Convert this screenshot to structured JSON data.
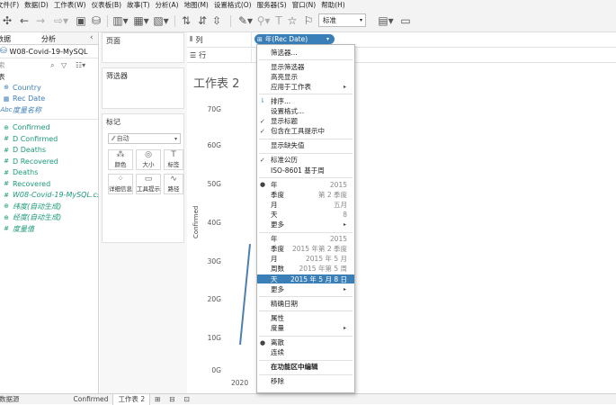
{
  "menubar": [
    "文件(F)",
    "数据(D)",
    "工作表(W)",
    "仪表板(B)",
    "故事(T)",
    "分析(A)",
    "地图(M)",
    "设置格式(O)",
    "服务器(S)",
    "窗口(N)",
    "帮助(H)"
  ],
  "toolbar": {
    "zoom_value": "标准"
  },
  "left_panel": {
    "tabs": [
      "数据",
      "分析"
    ],
    "datasource": "W08-Covid-19-MySQL",
    "search_placeholder": "索",
    "section_label": "表",
    "fields": [
      {
        "icon": "globe",
        "name": "Country",
        "kind": "dim"
      },
      {
        "icon": "calendar",
        "name": "Rec Date",
        "kind": "dim"
      },
      {
        "icon": "abc",
        "name": "度量名称",
        "kind": "dim",
        "italic": true
      },
      {
        "icon": "globe",
        "name": "Confirmed",
        "kind": "meas"
      },
      {
        "icon": "#",
        "name": "D Confirmed",
        "kind": "meas"
      },
      {
        "icon": "#",
        "name": "D Deaths",
        "kind": "meas"
      },
      {
        "icon": "#",
        "name": "D Recovered",
        "kind": "meas"
      },
      {
        "icon": "#",
        "name": "Deaths",
        "kind": "meas"
      },
      {
        "icon": "#",
        "name": "Recovered",
        "kind": "meas"
      },
      {
        "icon": "#",
        "name": "W08-Covid-19-MySQL.csv ...",
        "kind": "meas",
        "italic": true
      },
      {
        "icon": "globe",
        "name": "纬度(自动生成)",
        "kind": "meas",
        "italic": true
      },
      {
        "icon": "globe",
        "name": "经度(自动生成)",
        "kind": "meas",
        "italic": true
      },
      {
        "icon": "#",
        "name": "度量值",
        "kind": "meas",
        "italic": true
      }
    ]
  },
  "shelves": {
    "pages_label": "页面",
    "filters_label": "筛选器",
    "marks_label": "标记",
    "marks_type": "自动",
    "mark_buttons": [
      "颜色",
      "大小",
      "标签",
      "详细信息",
      "工具提示",
      "路径"
    ],
    "columns_label": "列",
    "rows_label": "行",
    "column_pill": "年(Rec Date)"
  },
  "view": {
    "sheet_title": "工作表 2",
    "y_axis_label": "Confirmed",
    "y_ticks": [
      "70G",
      "60G",
      "50G",
      "40G",
      "30G",
      "20G",
      "10G",
      "0G"
    ],
    "x_tick": "2020"
  },
  "chart_data": {
    "type": "line",
    "x": [
      "2020"
    ],
    "ylabel": "Confirmed",
    "ylim": [
      0,
      70000000000
    ],
    "series": [
      {
        "values": [
          7000000000,
          34000000000
        ]
      }
    ]
  },
  "context_menu": {
    "items": [
      {
        "label": "筛选器..."
      },
      {
        "sep": true
      },
      {
        "label": "显示筛选器"
      },
      {
        "label": "高亮显示"
      },
      {
        "label": "应用于工作表",
        "arrow": true
      },
      {
        "sep": true
      },
      {
        "label": "排序...",
        "icon": "sort"
      },
      {
        "label": "设置格式..."
      },
      {
        "label": "显示标题",
        "check": "✓"
      },
      {
        "label": "包含在工具提示中",
        "check": "✓"
      },
      {
        "sep": true
      },
      {
        "label": "显示缺失值"
      },
      {
        "sep": true
      },
      {
        "label": "标准公历",
        "check": "✓"
      },
      {
        "label": "ISO-8601 基于周"
      },
      {
        "sep": true
      },
      {
        "label": "年",
        "value": "2015",
        "check": "●"
      },
      {
        "label": "季度",
        "value": "第 2 季度"
      },
      {
        "label": "月",
        "value": "五月"
      },
      {
        "label": "天",
        "value": "8"
      },
      {
        "label": "更多",
        "arrow": true
      },
      {
        "sep": true
      },
      {
        "label": "年",
        "value": "2015"
      },
      {
        "label": "季度",
        "value": "2015 年第 2 季度"
      },
      {
        "label": "月",
        "value": "2015 年 5 月"
      },
      {
        "label": "周数",
        "value": "2015 年第 5 周"
      },
      {
        "label": "天",
        "value": "2015 年 5 月 8 日",
        "highlight": true
      },
      {
        "label": "更多",
        "arrow": true
      },
      {
        "sep": true
      },
      {
        "label": "精确日期"
      },
      {
        "sep": true
      },
      {
        "label": "属性"
      },
      {
        "label": "度量",
        "arrow": true
      },
      {
        "sep": true
      },
      {
        "label": "离散",
        "check": "●"
      },
      {
        "label": "连续"
      },
      {
        "sep": true
      },
      {
        "label": "在功能区中编辑",
        "bold": true
      },
      {
        "sep": true
      },
      {
        "label": "移除"
      }
    ]
  },
  "bottom_bar": {
    "tabs": [
      "数据源",
      "Confirmed",
      "工作表 2"
    ],
    "active": 2
  },
  "colors": {
    "accent": "#3a7fb8",
    "line": "#4f7fae"
  }
}
